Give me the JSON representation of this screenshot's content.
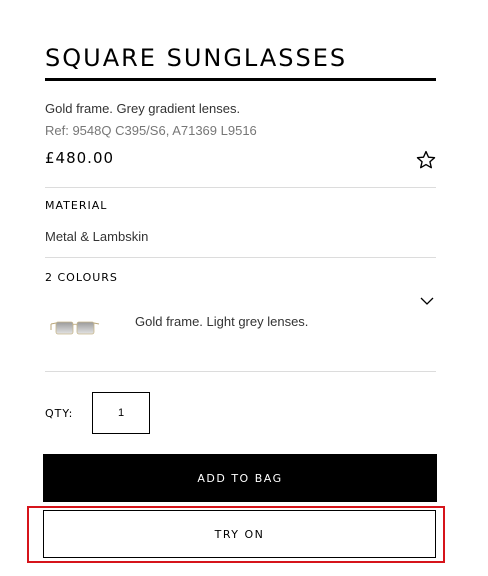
{
  "product": {
    "title": "SQUARE SUNGLASSES",
    "description": "Gold frame. Grey gradient lenses.",
    "reference": "Ref: 9548Q C395/S6, A71369 L9516",
    "price": "£480.00"
  },
  "material": {
    "label": "MATERIAL",
    "value": "Metal & Lambskin"
  },
  "colours": {
    "label": "2 COLOURS",
    "selected_name": "Gold frame. Light grey lenses."
  },
  "quantity": {
    "label": "QTY:",
    "value": "1"
  },
  "actions": {
    "add_to_bag": "ADD TO BAG",
    "try_on": "TRY ON"
  },
  "colors": {
    "highlight": "#d6141b",
    "primary_button": "#000000",
    "divider": "#dcdcdc"
  },
  "icons": {
    "wishlist": "star-outline-icon",
    "expand": "chevron-down-icon"
  }
}
